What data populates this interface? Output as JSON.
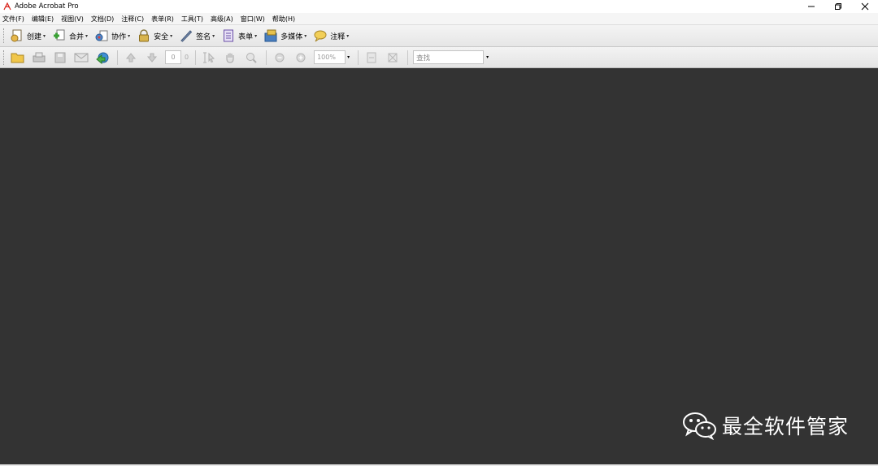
{
  "window": {
    "title": "Adobe Acrobat Pro"
  },
  "menubar": {
    "items": [
      {
        "label": "文件(F)"
      },
      {
        "label": "编辑(E)"
      },
      {
        "label": "视图(V)"
      },
      {
        "label": "文档(D)"
      },
      {
        "label": "注释(C)"
      },
      {
        "label": "表单(R)"
      },
      {
        "label": "工具(T)"
      },
      {
        "label": "高级(A)"
      },
      {
        "label": "窗口(W)"
      },
      {
        "label": "帮助(H)"
      }
    ]
  },
  "toolbar": {
    "buttons": [
      {
        "label": "创建",
        "icon": "create-pdf-icon"
      },
      {
        "label": "合并",
        "icon": "combine-icon"
      },
      {
        "label": "协作",
        "icon": "collaborate-icon"
      },
      {
        "label": "安全",
        "icon": "lock-icon"
      },
      {
        "label": "签名",
        "icon": "pen-icon"
      },
      {
        "label": "表单",
        "icon": "form-icon"
      },
      {
        "label": "多媒体",
        "icon": "multimedia-icon"
      },
      {
        "label": "注释",
        "icon": "comment-icon"
      }
    ]
  },
  "nav_toolbar": {
    "page_value": "0",
    "page_total": "0",
    "zoom_value": "100%",
    "search_placeholder": "查找"
  },
  "watermark": {
    "text": "最全软件管家"
  },
  "colors": {
    "workspace": "#333333",
    "accent": "#d9241c"
  }
}
